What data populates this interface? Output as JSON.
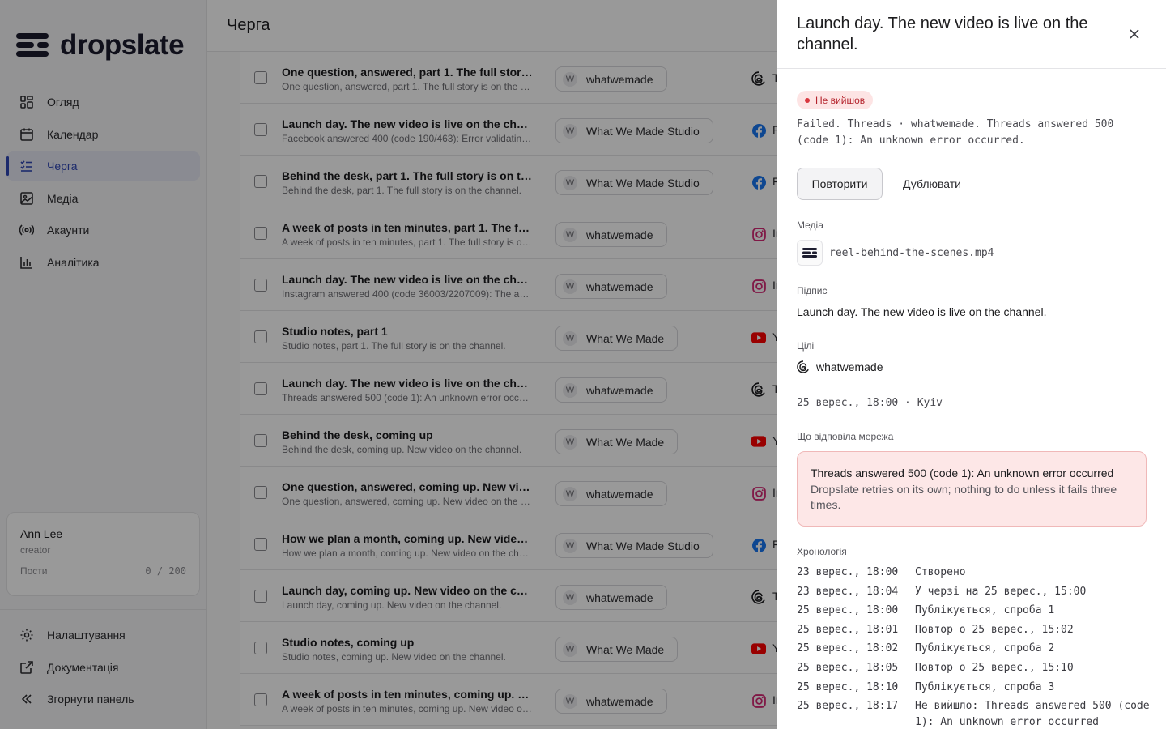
{
  "app": {
    "name": "dropslate"
  },
  "nav": {
    "items": [
      {
        "label": "Огляд",
        "icon": "dashboard-icon"
      },
      {
        "label": "Календар",
        "icon": "calendar-icon"
      },
      {
        "label": "Черга",
        "icon": "queue-icon",
        "active": true
      },
      {
        "label": "Медіа",
        "icon": "image-icon"
      },
      {
        "label": "Акаунти",
        "icon": "broadcast-icon"
      },
      {
        "label": "Аналітика",
        "icon": "chart-icon"
      }
    ],
    "bottom": [
      {
        "label": "Налаштування",
        "icon": "gear-icon"
      },
      {
        "label": "Документація",
        "icon": "external-link-icon"
      },
      {
        "label": "Згорнути панель",
        "icon": "chevrons-left-icon"
      }
    ]
  },
  "user": {
    "name": "Ann Lee",
    "role": "creator",
    "posts_label": "Пости",
    "posts_count": "0 / 200"
  },
  "page": {
    "title": "Черга"
  },
  "queue": [
    {
      "title": "One question, answered, part 1. The full story is on the channel.",
      "sub": "One question, answered, part 1. The full story is on the channel.",
      "avatar": "W",
      "account": "whatwemade",
      "network": "threads",
      "net_label": "T"
    },
    {
      "title": "Launch day. The new video is live on the channel.",
      "sub": "Facebook answered 400 (code 190/463): Error validating access token.",
      "avatar": "W",
      "account": "What We Made Studio",
      "network": "facebook",
      "net_label": "F"
    },
    {
      "title": "Behind the desk, part 1. The full story is on the channel.",
      "sub": "Behind the desk, part 1. The full story is on the channel.",
      "avatar": "W",
      "account": "What We Made Studio",
      "network": "facebook",
      "net_label": "F"
    },
    {
      "title": "A week of posts in ten minutes, part 1. The full story is on the channel.",
      "sub": "A week of posts in ten minutes, part 1. The full story is on the channel.",
      "avatar": "W",
      "account": "whatwemade",
      "network": "instagram",
      "net_label": "In"
    },
    {
      "title": "Launch day. The new video is live on the channel.",
      "sub": "Instagram answered 400 (code 36003/2207009): The aspect ratio is not supported.",
      "avatar": "W",
      "account": "whatwemade",
      "network": "instagram",
      "net_label": "In"
    },
    {
      "title": "Studio notes, part 1",
      "sub": "Studio notes, part 1. The full story is on the channel.",
      "avatar": "W",
      "account": "What We Made",
      "network": "youtube",
      "net_label": "Y"
    },
    {
      "title": "Launch day. The new video is live on the channel.",
      "sub": "Threads answered 500 (code 1): An unknown error occurred",
      "avatar": "W",
      "account": "whatwemade",
      "network": "threads",
      "net_label": "T"
    },
    {
      "title": "Behind the desk, coming up",
      "sub": "Behind the desk, coming up. New video on the channel.",
      "avatar": "W",
      "account": "What We Made",
      "network": "youtube",
      "net_label": "Y"
    },
    {
      "title": "One question, answered, coming up. New video on the channel.",
      "sub": "One question, answered, coming up. New video on the channel.",
      "avatar": "W",
      "account": "whatwemade",
      "network": "instagram",
      "net_label": "In"
    },
    {
      "title": "How we plan a month, coming up. New video on the channel.",
      "sub": "How we plan a month, coming up. New video on the channel.",
      "avatar": "W",
      "account": "What We Made Studio",
      "network": "facebook",
      "net_label": "F"
    },
    {
      "title": "Launch day, coming up. New video on the channel.",
      "sub": "Launch day, coming up. New video on the channel.",
      "avatar": "W",
      "account": "whatwemade",
      "network": "threads",
      "net_label": "T"
    },
    {
      "title": "Studio notes, coming up",
      "sub": "Studio notes, coming up. New video on the channel.",
      "avatar": "W",
      "account": "What We Made",
      "network": "youtube",
      "net_label": "Y"
    },
    {
      "title": "A week of posts in ten minutes, coming up. New video on the channel.",
      "sub": "A week of posts in ten minutes, coming up. New video on the channel.",
      "avatar": "W",
      "account": "whatwemade",
      "network": "instagram",
      "net_label": "In"
    }
  ],
  "drawer": {
    "title": "Launch day. The new video is live on the channel.",
    "status": "Не вийшов",
    "fail_text": "Failed. Threads · whatwemade. Threads answered 500 (code 1): An unknown error occurred.",
    "retry_label": "Повторити",
    "duplicate_label": "Дублювати",
    "media_label": "Медіа",
    "media_file": "reel-behind-the-scenes.mp4",
    "caption_label": "Підпис",
    "caption": "Launch day. The new video is live on the channel.",
    "targets_label": "Цілі",
    "target_account": "whatwemade",
    "schedule": "25 верес., 18:00 · Kyiv",
    "response_label": "Що відповіла мережа",
    "error_title": "Threads answered 500 (code 1): An unknown error occurred",
    "error_desc": "Dropslate retries on its own; nothing to do unless it fails three times.",
    "timeline_label": "Хронологія",
    "timeline": [
      {
        "time": "23 верес., 18:00",
        "text": "Створено"
      },
      {
        "time": "23 верес., 18:04",
        "text": "У черзі на 25 верес., 15:00"
      },
      {
        "time": "25 верес., 18:00",
        "text": "Публікується, спроба 1"
      },
      {
        "time": "25 верес., 18:01",
        "text": "Повтор о 25 верес., 15:02"
      },
      {
        "time": "25 верес., 18:02",
        "text": "Публікується, спроба 2"
      },
      {
        "time": "25 верес., 18:05",
        "text": "Повтор о 25 верес., 15:10"
      },
      {
        "time": "25 верес., 18:10",
        "text": "Публікується, спроба 3"
      },
      {
        "time": "25 верес., 18:17",
        "text": "Не вийшло: Threads answered 500 (code 1): An unknown error occurred"
      }
    ]
  },
  "colors": {
    "accent": "#2f46b5",
    "error_bg": "#fde7e7",
    "error_text": "#b4232c"
  }
}
